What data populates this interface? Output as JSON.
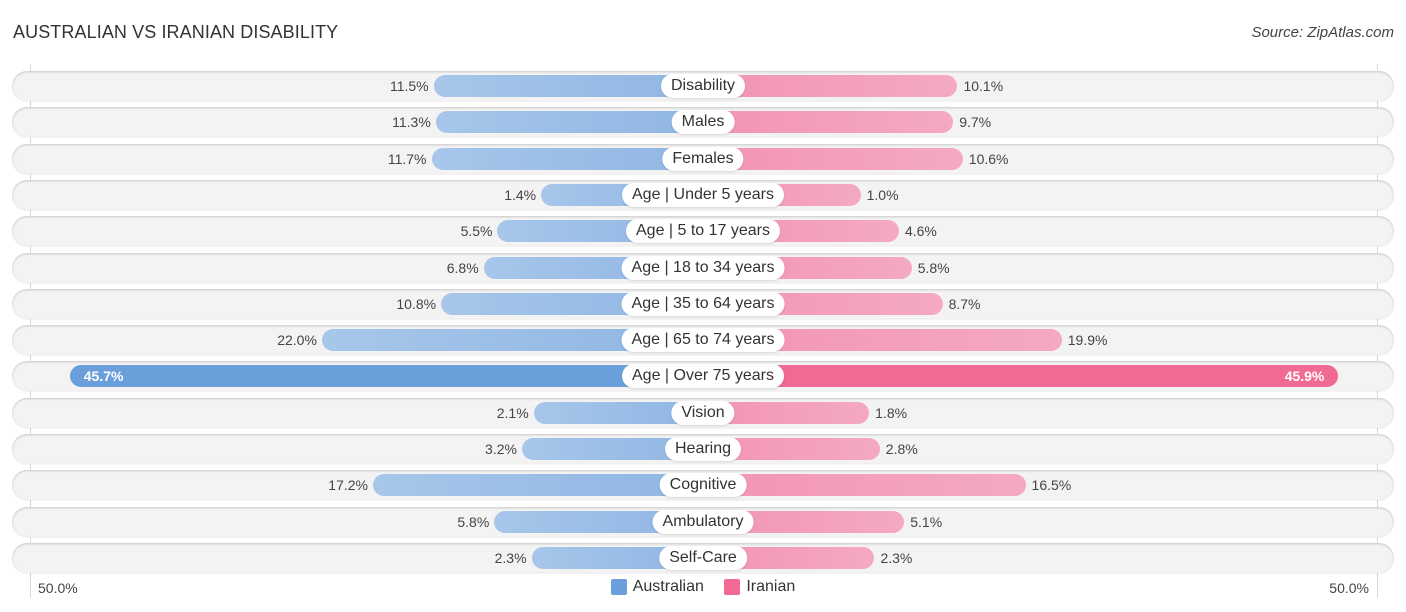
{
  "chart_data": {
    "type": "bar",
    "orientation": "horizontal-diverging",
    "title": "AUSTRALIAN VS IRANIAN DISABILITY",
    "source": "Source: ZipAtlas.com",
    "categories": [
      "Disability",
      "Males",
      "Females",
      "Age | Under 5 years",
      "Age | 5 to 17 years",
      "Age | 18 to 34 years",
      "Age | 35 to 64 years",
      "Age | 65 to 74 years",
      "Age | Over 75 years",
      "Vision",
      "Hearing",
      "Cognitive",
      "Ambulatory",
      "Self-Care"
    ],
    "series": [
      {
        "name": "Australian",
        "color": "#6a9fdb",
        "values": [
          11.5,
          11.3,
          11.7,
          1.4,
          5.5,
          6.8,
          10.8,
          22.0,
          45.7,
          2.1,
          3.2,
          17.2,
          5.8,
          2.3
        ]
      },
      {
        "name": "Iranian",
        "color": "#f06a94",
        "values": [
          10.1,
          9.7,
          10.6,
          1.0,
          4.6,
          5.8,
          8.7,
          19.9,
          45.9,
          1.8,
          2.8,
          16.5,
          5.1,
          2.3
        ]
      }
    ],
    "value_labels_left": [
      "11.5%",
      "11.3%",
      "11.7%",
      "1.4%",
      "5.5%",
      "6.8%",
      "10.8%",
      "22.0%",
      "45.7%",
      "2.1%",
      "3.2%",
      "17.2%",
      "5.8%",
      "2.3%"
    ],
    "value_labels_right": [
      "10.1%",
      "9.7%",
      "10.6%",
      "1.0%",
      "4.6%",
      "5.8%",
      "8.7%",
      "19.9%",
      "45.9%",
      "1.8%",
      "2.8%",
      "16.5%",
      "5.1%",
      "2.3%"
    ],
    "axis_min_label": "50.0%",
    "axis_max_label": "50.0%",
    "xlim": [
      -50,
      50
    ],
    "legend_position": "bottom-center"
  }
}
